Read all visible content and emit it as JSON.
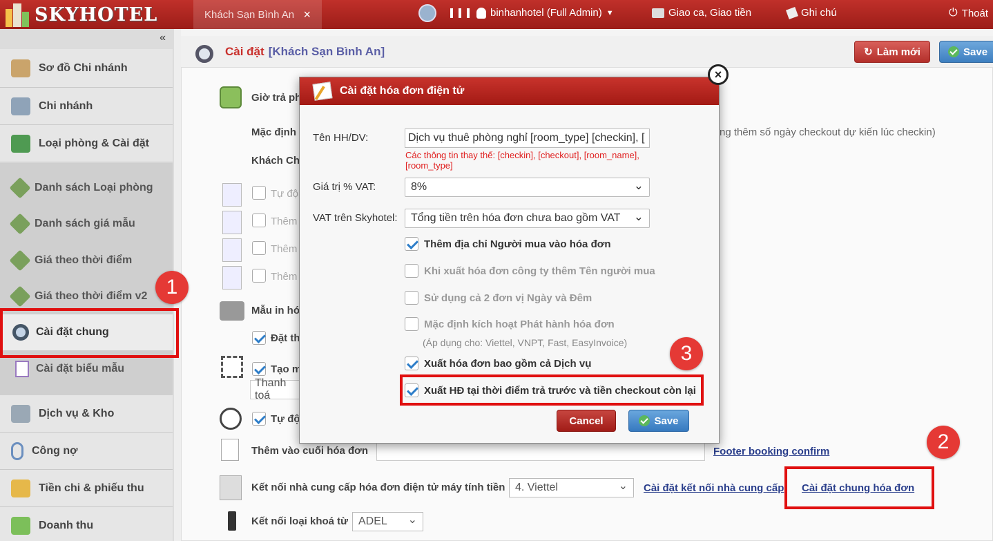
{
  "app": {
    "logo": "SKYHOTEL"
  },
  "topbar": {
    "hotel_tab": "Khách Sạn Bình An",
    "close_tab": "×",
    "user": "binhanhotel (Full Admin)",
    "shift": "Giao ca, Giao tiền",
    "note": "Ghi chú",
    "logout": "Thoát"
  },
  "sidebar": {
    "collapse": "«",
    "items": [
      {
        "label": "Sơ đồ Chi nhánh"
      },
      {
        "label": "Chi nhánh"
      },
      {
        "label": "Loại phòng & Cài đặt"
      }
    ],
    "sub_items": [
      {
        "label": "Danh sách Loại phòng"
      },
      {
        "label": "Danh sách giá mẫu"
      },
      {
        "label": "Giá theo thời điểm"
      },
      {
        "label": "Giá theo thời điểm v2"
      },
      {
        "label": "Cài đặt chung"
      },
      {
        "label": "Cài đặt biểu mẫu"
      }
    ],
    "bottom_items": [
      {
        "label": "Dịch vụ & Kho"
      },
      {
        "label": "Công nợ"
      },
      {
        "label": "Tiền chi & phiếu thu"
      },
      {
        "label": "Doanh thu"
      }
    ]
  },
  "page": {
    "title": "Cài đặt",
    "hotel": "[Khách Sạn Bình An]",
    "refresh_label": "Làm mới",
    "save_label": "Save"
  },
  "background": {
    "checkout_time": "Giờ trả ph",
    "default_label": "Mặc định",
    "guest_label": "Khách Ch",
    "hint_right": "ng thêm số ngày checkout dự kiến lúc checkin)",
    "auto1": "Tự độ",
    "add1": "Thêm",
    "add2": "Thêm",
    "add3": "Thêm",
    "print_template": "Mẫu in hó",
    "set_label": "Đặt th",
    "create_label": "Tạo m",
    "payment_value": "Thanh toá",
    "auto2": "Tự độ",
    "footer_label": "Thêm vào cuối hóa đơn",
    "footer_link": "Footer booking confirm",
    "provider_label": "Kết nối nhà cung cấp hóa đơn điện tử máy tính tiền",
    "provider_value": "4. Viettel",
    "provider_link": "Cài đặt kết nối nhà cung cấp",
    "general_invoice_link": "Cài đặt chung hóa đơn",
    "lock_label": "Kết nối loại khoá từ",
    "lock_value": "ADEL"
  },
  "dialog": {
    "title": "Cài đặt hóa đơn điện tử",
    "close": "×",
    "service_name_label": "Tên HH/DV:",
    "service_name_value": "Dịch vụ thuê phòng nghỉ [room_type] [checkin], [",
    "replace_hint": "Các thông tin thay thế: [checkin], [checkout], [room_name], [room_type]",
    "vat_label": "Giá trị % VAT:",
    "vat_value": "8%",
    "vat_sky_label": "VAT trên Skyhotel:",
    "vat_sky_value": "Tổng tiền trên hóa đơn chưa bao gồm VAT",
    "options": [
      {
        "label": "Thêm địa chỉ Người mua vào hóa đơn",
        "checked": true
      },
      {
        "label": "Khi xuất hóa đơn công ty thêm Tên người mua",
        "checked": false
      },
      {
        "label": "Sử dụng cả 2 đơn vị Ngày và Đêm",
        "checked": false
      },
      {
        "label": "Mặc định kích hoạt Phát hành hóa đơn",
        "checked": false
      },
      {
        "label": "Xuất hóa đơn bao gồm cả Dịch vụ",
        "checked": true
      },
      {
        "label": "Xuất HĐ tại thời điểm trả trước và tiền checkout còn lại",
        "checked": true
      }
    ],
    "apply_hint": "(Áp dụng cho: Viettel, VNPT, Fast, EasyInvoice)",
    "cancel_label": "Cancel",
    "save_label": "Save"
  },
  "annotations": {
    "step1": "1",
    "step2": "2",
    "step3": "3"
  }
}
